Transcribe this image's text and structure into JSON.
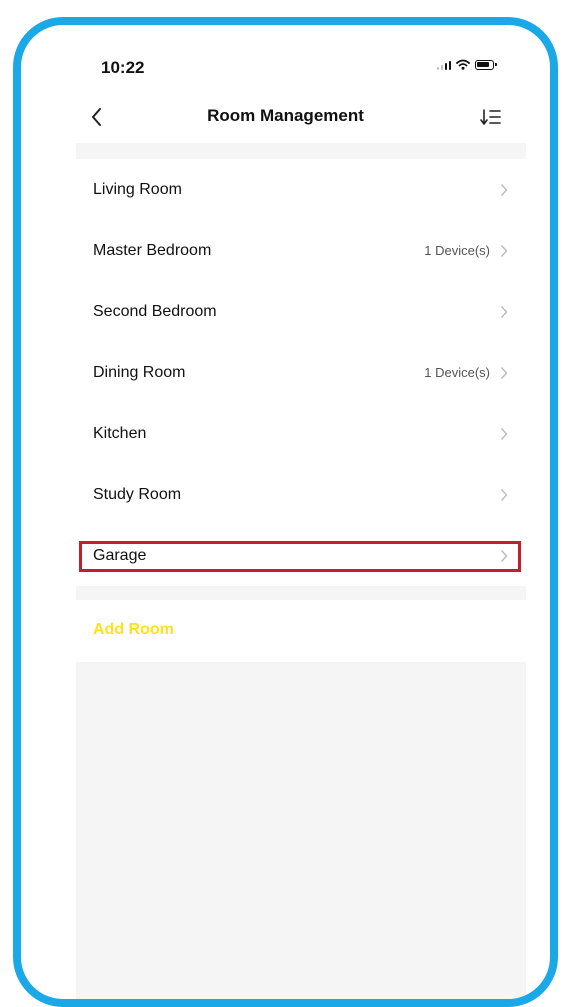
{
  "status_bar": {
    "time": "10:22"
  },
  "nav": {
    "title": "Room Management"
  },
  "rooms": [
    {
      "name": "Living Room",
      "count": ""
    },
    {
      "name": "Master Bedroom",
      "count": "1 Device(s)"
    },
    {
      "name": "Second Bedroom",
      "count": ""
    },
    {
      "name": "Dining Room",
      "count": "1 Device(s)"
    },
    {
      "name": "Kitchen",
      "count": ""
    },
    {
      "name": "Study Room",
      "count": ""
    },
    {
      "name": "Garage",
      "count": ""
    }
  ],
  "add_room_label": "Add Room",
  "colors": {
    "frame": "#1aa9e6",
    "highlight": "#c0202e",
    "accent": "#ffe21a",
    "background": "#f5f5f5"
  }
}
